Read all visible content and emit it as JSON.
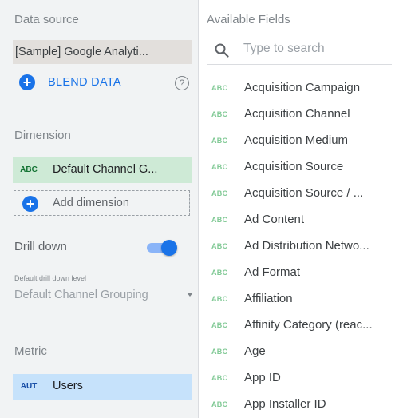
{
  "left_panel": {
    "data_source": {
      "title": "Data source",
      "value": "[Sample] Google Analyti...",
      "blend_label": "BLEND DATA",
      "help_icon": "help-circle-icon"
    },
    "dimension": {
      "title": "Dimension",
      "chip": {
        "type_label": "ABC",
        "name": "Default Channel G..."
      },
      "add_label": "Add dimension"
    },
    "drill_down": {
      "label": "Drill down",
      "enabled": true,
      "level_label": "Default drill down level",
      "level_value": "Default Channel Grouping"
    },
    "metric": {
      "title": "Metric",
      "chip": {
        "type_label": "AUT",
        "name": "Users"
      }
    }
  },
  "right_panel": {
    "title": "Available Fields",
    "search": {
      "placeholder": "Type to search",
      "value": ""
    },
    "fields": [
      {
        "type": "ABC",
        "name": "Acquisition Campaign"
      },
      {
        "type": "ABC",
        "name": "Acquisition Channel"
      },
      {
        "type": "ABC",
        "name": "Acquisition Medium"
      },
      {
        "type": "ABC",
        "name": "Acquisition Source"
      },
      {
        "type": "ABC",
        "name": "Acquisition Source / ..."
      },
      {
        "type": "ABC",
        "name": "Ad Content"
      },
      {
        "type": "ABC",
        "name": "Ad Distribution Netwo..."
      },
      {
        "type": "ABC",
        "name": "Ad Format"
      },
      {
        "type": "ABC",
        "name": "Affiliation"
      },
      {
        "type": "ABC",
        "name": "Affinity Category (reac..."
      },
      {
        "type": "ABC",
        "name": "Age"
      },
      {
        "type": "ABC",
        "name": "App ID"
      },
      {
        "type": "ABC",
        "name": "App Installer ID"
      }
    ]
  },
  "colors": {
    "accent": "#1a73e8",
    "dimension_chip": "#ceead6",
    "metric_chip": "#c6e2fb",
    "panel_bg": "#f1f3f4"
  }
}
